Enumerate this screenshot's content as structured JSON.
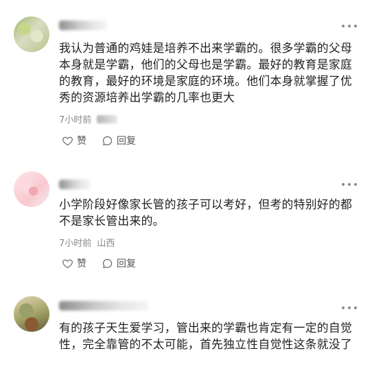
{
  "comments": [
    {
      "text": "我认为普通的鸡娃是培养不出来学霸的。很多学霸的父母本身就是学霸，他们的父母也是学霸。最好的教育是家庭的教育，最好的环境是家庭的环境。他们本身就掌握了优秀的资源培养出学霸的几率也更大",
      "time": "7小时前",
      "location": "",
      "like_label": "赞",
      "reply_label": "回复",
      "like_icon": "heart-icon",
      "reply_icon": "comment-bubble-icon"
    },
    {
      "text": "小学阶段好像家长管的孩子可以考好，但考的特别好的都不是家长管出来的。",
      "time": "7小时前",
      "location": "山西",
      "like_label": "赞",
      "reply_label": "回复",
      "like_icon": "heart-icon",
      "reply_icon": "comment-bubble-icon"
    },
    {
      "text": "有的孩子天生爱学习，管出来的学霸也肯定有一定的自觉性，完全靠管的不太可能，首先独立性自觉性这条就没了",
      "time": "",
      "location": "",
      "like_label": "",
      "reply_label": "",
      "like_icon": "",
      "reply_icon": ""
    }
  ],
  "more_icon": "more-horizontal-icon",
  "colors": {
    "text": "#1f1f1f",
    "meta": "#888888",
    "action": "#555555",
    "icon": "#8a8a8a"
  }
}
